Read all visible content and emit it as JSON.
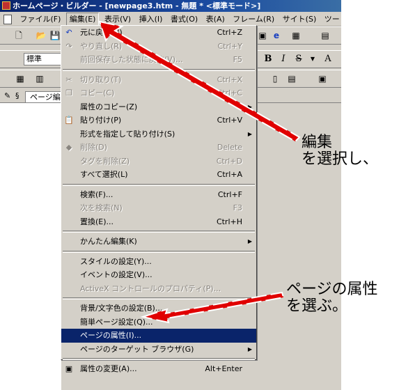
{
  "window": {
    "title": "ホームページ・ビルダー - [newpage3.htm - 無題 * <標準モード>]"
  },
  "menubar": [
    "ファイル(F)",
    "編集(E)",
    "表示(V)",
    "挿入(I)",
    "書式(O)",
    "表(A)",
    "フレーム(R)",
    "サイト(S)",
    "ツー"
  ],
  "toolbar": {
    "style_combo": "標準",
    "bold": "B",
    "italic": "I",
    "strike": "S",
    "font_size": "A"
  },
  "tabs": {
    "page_edit": "ページ編"
  },
  "edit_menu": {
    "items": [
      {
        "label": "元に戻す(U)",
        "shortcut": "Ctrl+Z",
        "icon": "undo-icon"
      },
      {
        "label": "やり直し(R)",
        "shortcut": "Ctrl+Y",
        "icon": "redo-icon"
      },
      {
        "label": "前回保存した状態に戻す(V)...",
        "shortcut": "F5"
      },
      {
        "label": "切り取り(T)",
        "shortcut": "Ctrl+X",
        "icon": "cut-icon"
      },
      {
        "label": "コピー(C)",
        "shortcut": "Ctrl+C",
        "icon": "copy-icon"
      },
      {
        "label": "属性のコピー(Z)",
        "shortcut": ""
      },
      {
        "label": "貼り付け(P)",
        "shortcut": "Ctrl+V",
        "icon": "paste-icon"
      },
      {
        "label": "形式を指定して貼り付け(S)",
        "shortcut": ""
      },
      {
        "label": "削除(D)",
        "shortcut": "Delete",
        "icon": "delete-icon"
      },
      {
        "label": "タグを削除(Z)",
        "shortcut": "Ctrl+D"
      },
      {
        "label": "すべて選択(L)",
        "shortcut": "Ctrl+A"
      },
      {
        "label": "検索(F)...",
        "shortcut": "Ctrl+F"
      },
      {
        "label": "次を検索(N)",
        "shortcut": "F3"
      },
      {
        "label": "置換(E)...",
        "shortcut": "Ctrl+H"
      },
      {
        "label": "かんたん編集(K)",
        "shortcut": ""
      },
      {
        "label": "スタイルの設定(Y)...",
        "shortcut": ""
      },
      {
        "label": "イベントの設定(V)...",
        "shortcut": ""
      },
      {
        "label": "ActiveX コントロールのプロパティ(P)...",
        "shortcut": ""
      },
      {
        "label": "背景/文字色の設定(B)...",
        "shortcut": ""
      },
      {
        "label": "簡単ページ設定(Q)...",
        "shortcut": ""
      },
      {
        "label": "ページの属性(I)...",
        "shortcut": ""
      },
      {
        "label": "ページのターゲット ブラウザ(G)",
        "shortcut": ""
      },
      {
        "label": "属性の変更(A)...",
        "shortcut": "Alt+Enter",
        "icon": "properties-icon"
      }
    ]
  },
  "annotations": {
    "callout1_line1": "編集",
    "callout1_line2": "を選択し、",
    "callout2_line1": "ページの属性",
    "callout2_line2": "を選ぶ。",
    "arrow_color": "#e00000"
  },
  "colors": {
    "menu_bg": "#d4d0c8",
    "selection": "#0a246a",
    "titlebar": "#0a246a"
  }
}
